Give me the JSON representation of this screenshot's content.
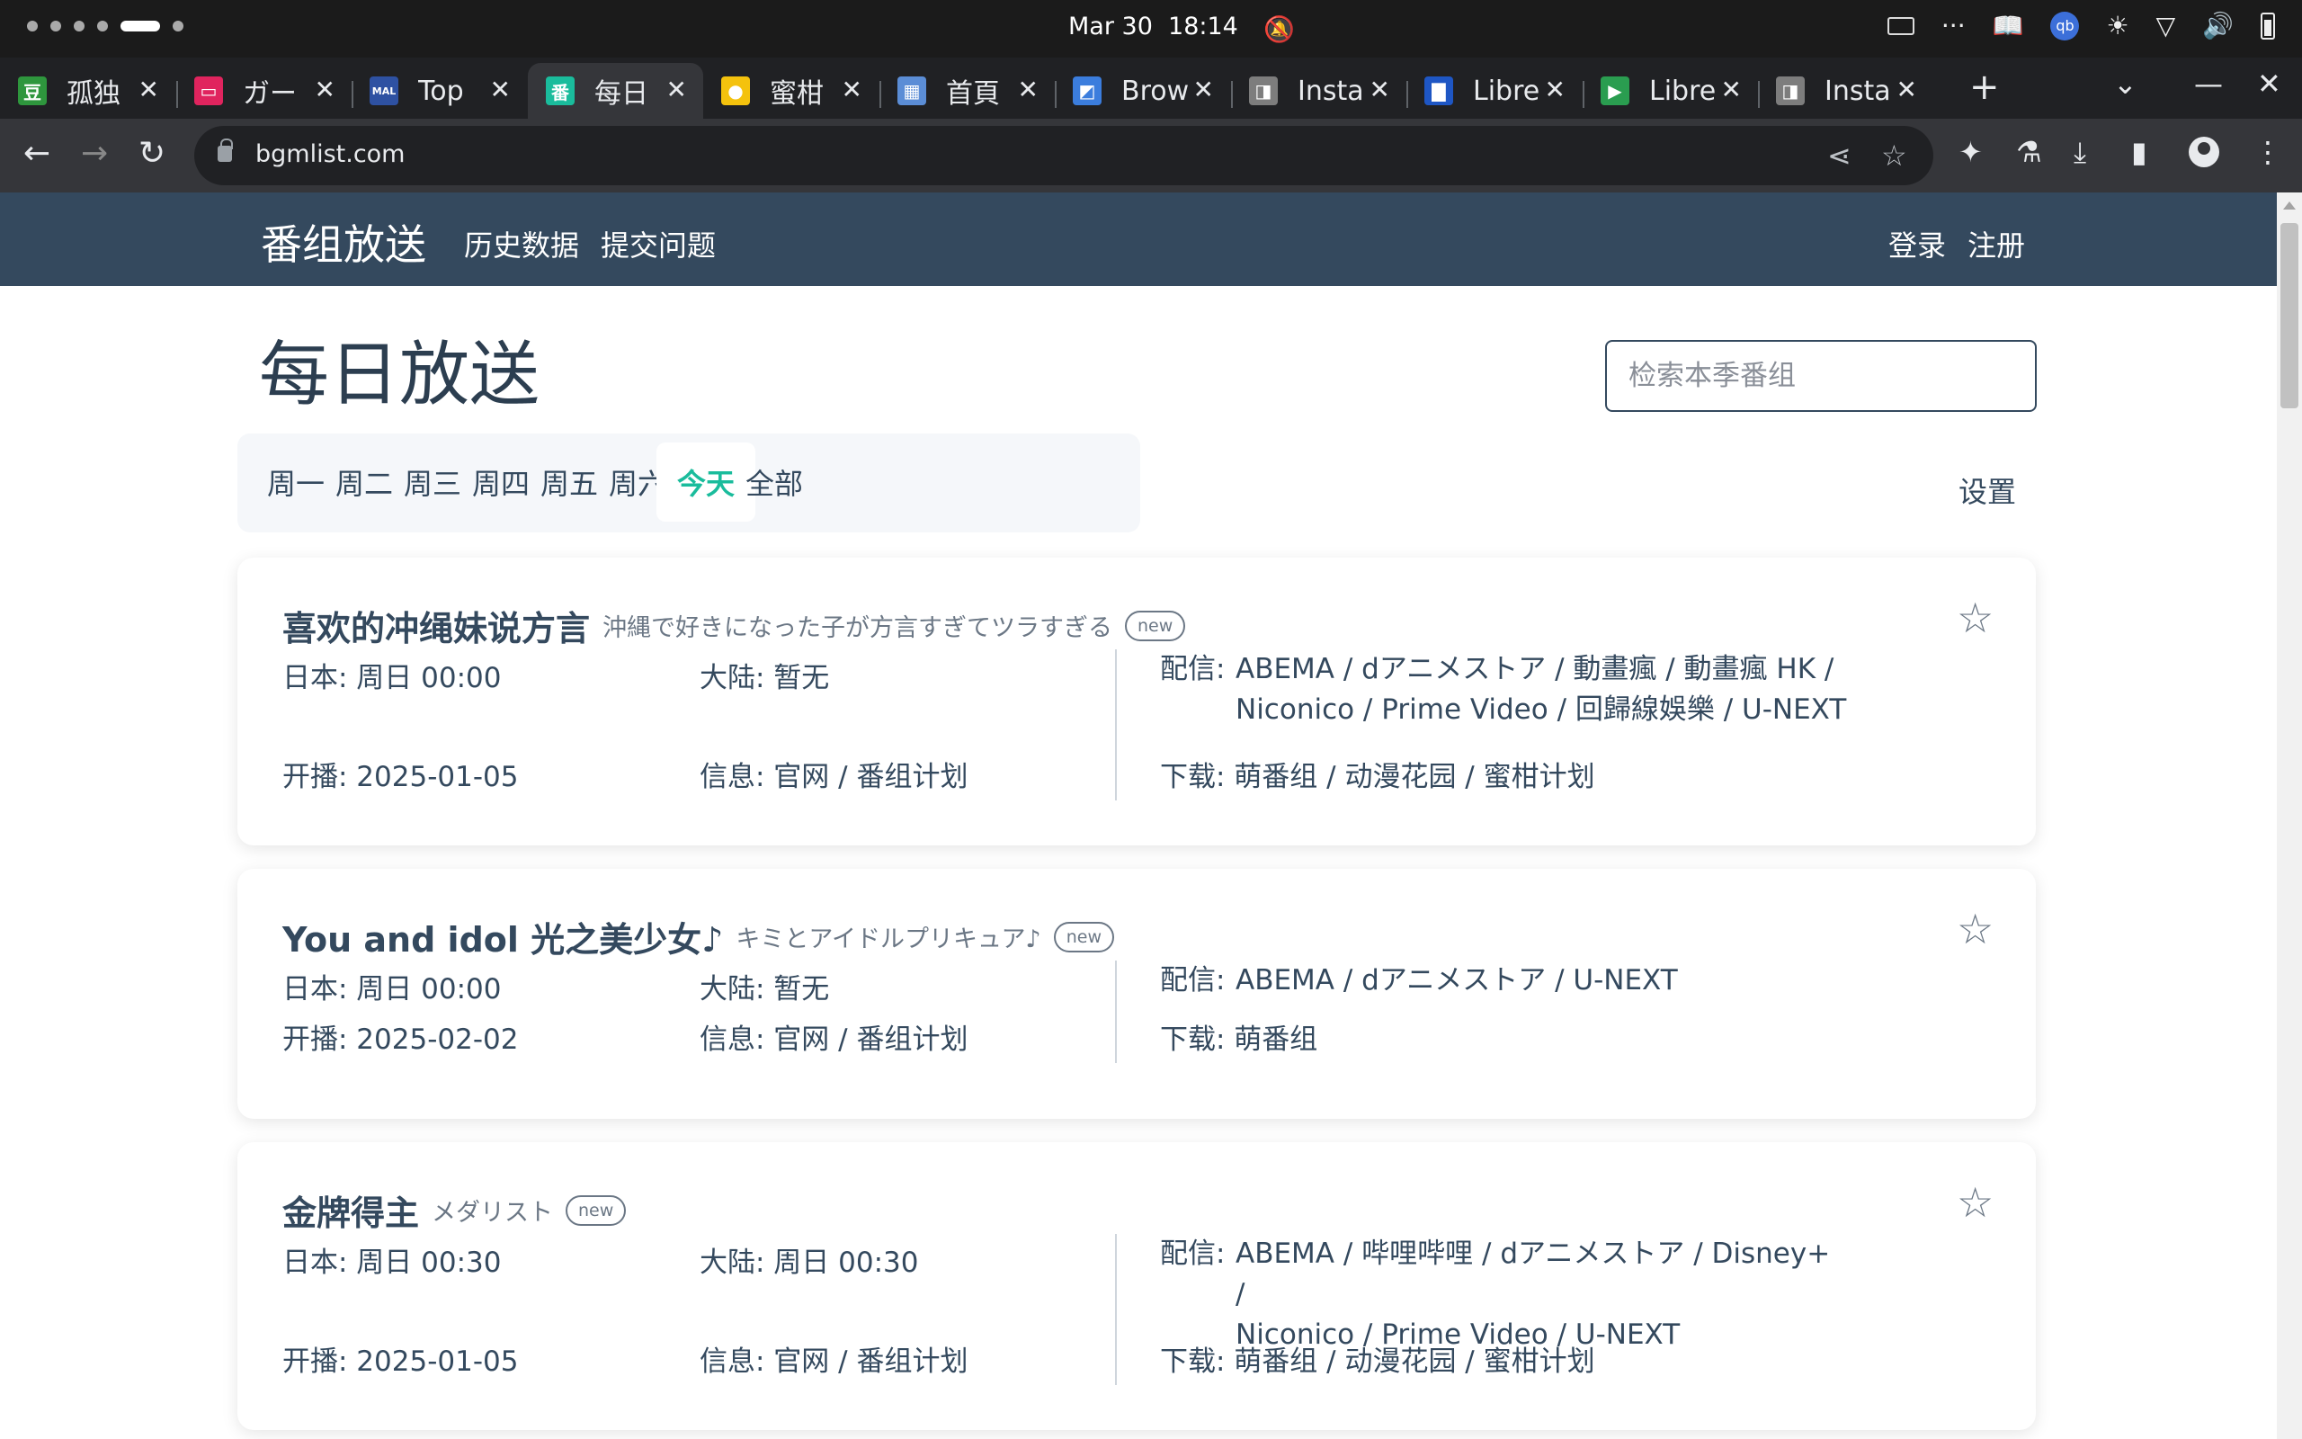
{
  "os": {
    "clock": "Mar 30  18:14",
    "tray": {
      "more": "···"
    }
  },
  "browser": {
    "tabs": [
      {
        "title": "孤独",
        "fav_text": "豆",
        "fav_color": "#2e963d"
      },
      {
        "title": "ガー",
        "fav_text": "▭",
        "fav_color": "#e0245e"
      },
      {
        "title": "Top",
        "fav_text": "MAL",
        "fav_color": "#2e51a2"
      },
      {
        "title": "每日",
        "fav_text": "番",
        "fav_color": "#1abc9c"
      },
      {
        "title": "蜜柑",
        "fav_text": "●",
        "fav_color": "#f4c20d"
      },
      {
        "title": "首頁",
        "fav_text": "▦",
        "fav_color": "#5b8dd6"
      },
      {
        "title": "Brow",
        "fav_text": "◩",
        "fav_color": "#3b7ddd"
      },
      {
        "title": "Insta",
        "fav_text": "◨",
        "fav_color": "#7d7d7d"
      },
      {
        "title": "Libre",
        "fav_text": "▇",
        "fav_color": "#1e56c4"
      },
      {
        "title": "Libre",
        "fav_text": "▶",
        "fav_color": "#2a9d50"
      },
      {
        "title": "Insta",
        "fav_text": "◨",
        "fav_color": "#7d7d7d"
      }
    ],
    "active_tab_index": 3,
    "url": "bgmlist.com"
  },
  "site": {
    "brand": "番组放送",
    "nav": {
      "history": "历史数据",
      "issue": "提交问题",
      "login": "登录",
      "register": "注册"
    },
    "page_title": "每日放送",
    "search_placeholder": "检索本季番组",
    "day_tabs": [
      "周一",
      "周二",
      "周三",
      "周四",
      "周五",
      "周六",
      "今天",
      "全部"
    ],
    "active_day": "今天",
    "settings": "设置",
    "accent": "#1abc9c",
    "nav_bg": "#34495e"
  },
  "shows": [
    {
      "title_cn": "喜欢的冲绳妹说方言",
      "title_jp": "沖縄で好きになった子が方言すぎてツラすぎる",
      "badge": "new",
      "japan": "日本: 周日 00:00",
      "mainland": "大陆: 暂无",
      "premiere": "开播: 2025-01-05",
      "info": "信息: 官网 / 番组计划",
      "stream_label": "配信:",
      "stream_lines": [
        "ABEMA / dアニメストア / 動畫瘋 / 動畫瘋 HK /",
        "Niconico / Prime Video / 回歸線娛樂 / U-NEXT"
      ],
      "download": "下载: 萌番组 / 动漫花园 / 蜜柑计划"
    },
    {
      "title_cn": "You and idol 光之美少女♪",
      "title_jp": "キミとアイドルプリキュア♪",
      "badge": "new",
      "japan": "日本: 周日 00:00",
      "mainland": "大陆: 暂无",
      "premiere": "开播: 2025-02-02",
      "info": "信息: 官网 / 番组计划",
      "stream_label": "配信:",
      "stream_lines": [
        "ABEMA / dアニメストア / U-NEXT"
      ],
      "download": "下载: 萌番组"
    },
    {
      "title_cn": "金牌得主",
      "title_jp": "メダリスト",
      "badge": "new",
      "japan": "日本: 周日 00:30",
      "mainland": "大陆: 周日 00:30",
      "premiere": "开播: 2025-01-05",
      "info": "信息: 官网 / 番组计划",
      "stream_label": "配信:",
      "stream_lines": [
        "ABEMA / 哔哩哔哩 / dアニメストア / Disney+ /",
        "Niconico / Prime Video / U-NEXT"
      ],
      "download": "下载: 萌番组 / 动漫花园 / 蜜柑计划"
    }
  ]
}
